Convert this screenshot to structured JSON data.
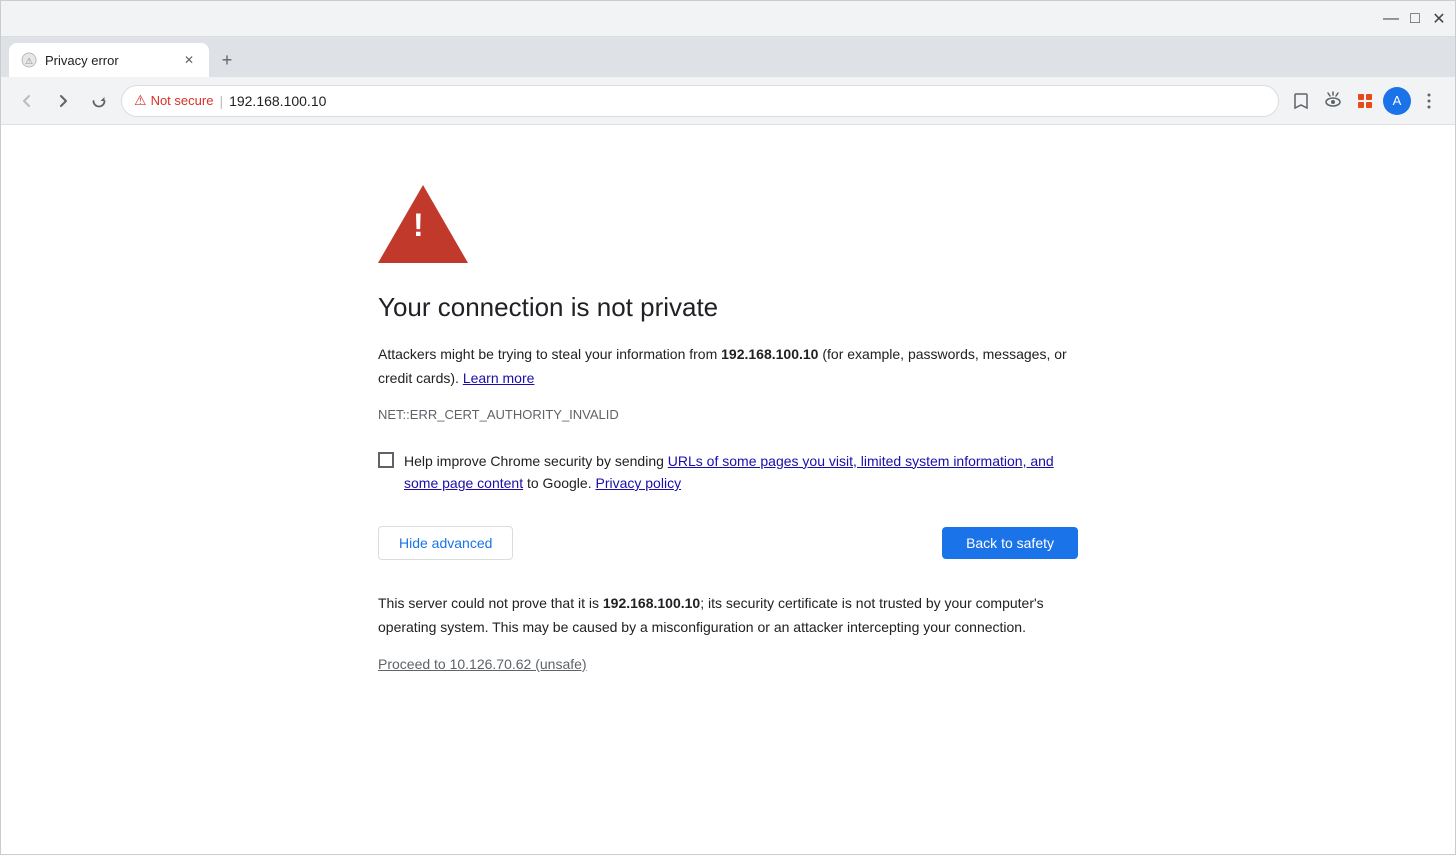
{
  "window": {
    "title": "Privacy error",
    "controls": {
      "minimize": "—",
      "maximize": "□",
      "close": "✕"
    }
  },
  "tab": {
    "title": "Privacy error",
    "favicon": "⚠"
  },
  "address_bar": {
    "not_secure_label": "Not secure",
    "url": "192.168.100.10",
    "divider": "|"
  },
  "error_page": {
    "warning_icon_alt": "warning triangle",
    "title": "Your connection is not private",
    "description_before": "Attackers might be trying to steal your information from ",
    "ip_address": "192.168.100.10",
    "description_after": " (for example, passwords, messages, or credit cards).",
    "learn_more": "Learn more",
    "error_code": "NET::ERR_CERT_AUTHORITY_INVALID",
    "checkbox_label_before": "Help improve Chrome security by sending ",
    "checkbox_link": "URLs of some pages you visit, limited system information, and some page content",
    "checkbox_label_middle": " to Google.",
    "privacy_policy": "Privacy policy",
    "hide_advanced_label": "Hide advanced",
    "back_to_safety_label": "Back to safety",
    "advanced_text_before": "This server could not prove that it is ",
    "advanced_ip": "192.168.100.10",
    "advanced_text_after": "; its security certificate is not trusted by your computer's operating system. This may be caused by a misconfiguration or an attacker intercepting your connection.",
    "proceed_link": "Proceed to 10.126.70.62 (unsafe)"
  }
}
